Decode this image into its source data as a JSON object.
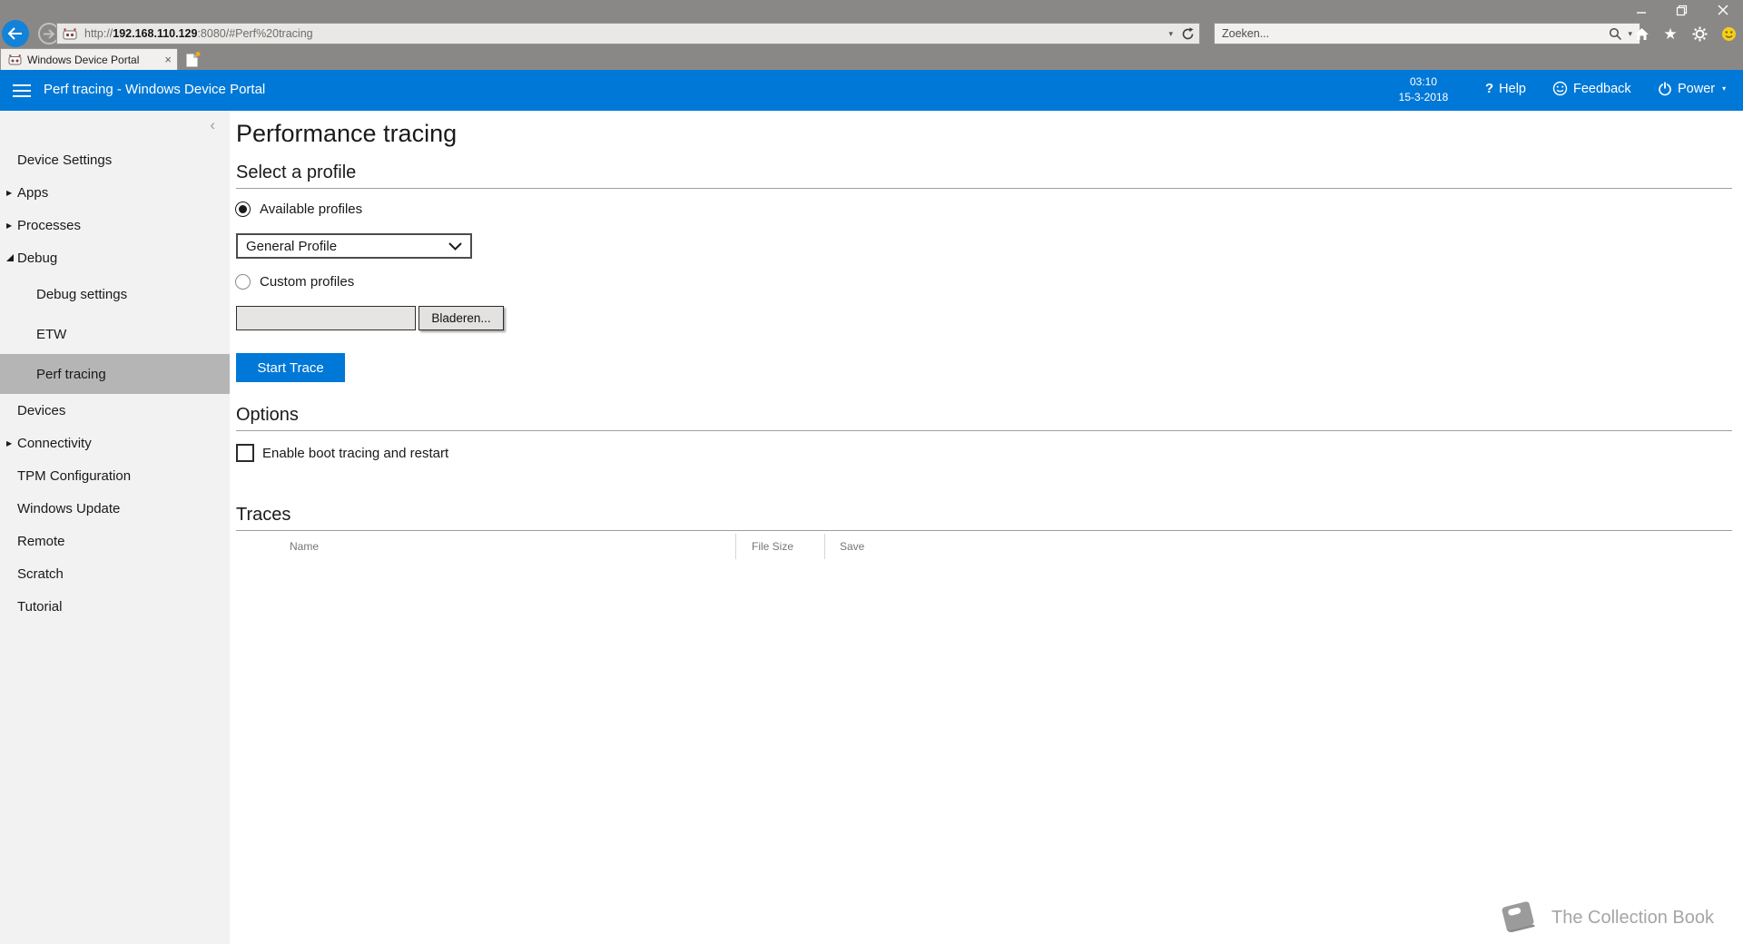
{
  "browser": {
    "icons": {
      "back": "arrow-left",
      "forward": "arrow-right",
      "refresh": "refresh-arrow",
      "address_dropdown": "▾",
      "search_magnifier": "magnifier",
      "search_dropdown": "▾",
      "home": "home",
      "favorites": "★",
      "settings": "gear",
      "smiley": "feedback-smiley",
      "minimize": "minimize",
      "restore": "restore",
      "close": "close"
    },
    "address": {
      "protocol": "http://",
      "host": "192.168.110.129",
      "path": ":8080/#Perf%20tracing"
    },
    "search": {
      "placeholder": "Zoeken..."
    },
    "tab": {
      "title": "Windows Device Portal",
      "close_icon": "×"
    },
    "chrome_color": "#8a8886"
  },
  "app_header": {
    "accent_color": "#0078d7",
    "title": "Perf tracing - Windows Device Portal",
    "time": "03:10",
    "date": "15-3-2018",
    "help": {
      "icon": "?",
      "label": "Help"
    },
    "feedback": {
      "label": "Feedback"
    },
    "power": {
      "label": "Power",
      "caret": "▾"
    }
  },
  "sidebar": {
    "collapse_icon": "‹",
    "selected_bg": "#b5b5b5",
    "items": [
      {
        "label": "Device Settings",
        "state": "plain",
        "selected": false
      },
      {
        "label": "Apps",
        "state": "collapsed",
        "selected": false
      },
      {
        "label": "Processes",
        "state": "collapsed",
        "selected": false
      },
      {
        "label": "Debug",
        "state": "expanded",
        "selected": false
      },
      {
        "label": "Debug settings",
        "state": "sub",
        "selected": false
      },
      {
        "label": "ETW",
        "state": "sub",
        "selected": false
      },
      {
        "label": "Perf tracing",
        "state": "sub",
        "selected": true
      },
      {
        "label": "Devices",
        "state": "plain",
        "selected": false
      },
      {
        "label": "Connectivity",
        "state": "collapsed",
        "selected": false
      },
      {
        "label": "TPM Configuration",
        "state": "plain",
        "selected": false
      },
      {
        "label": "Windows Update",
        "state": "plain",
        "selected": false
      },
      {
        "label": "Remote",
        "state": "plain",
        "selected": false
      },
      {
        "label": "Scratch",
        "state": "plain",
        "selected": false
      },
      {
        "label": "Tutorial",
        "state": "plain",
        "selected": false
      }
    ]
  },
  "main": {
    "page_title": "Performance tracing",
    "profile": {
      "heading": "Select a profile",
      "available_radio": {
        "label": "Available profiles",
        "selected": true
      },
      "profile_select": {
        "value": "General Profile"
      },
      "custom_radio": {
        "label": "Custom profiles",
        "selected": false
      },
      "file_input": {
        "value": "",
        "browse_label": "Bladeren..."
      },
      "start_button": "Start Trace"
    },
    "options": {
      "heading": "Options",
      "boot_checkbox": {
        "label": "Enable boot tracing and restart",
        "checked": false
      }
    },
    "traces": {
      "heading": "Traces",
      "columns": [
        "Name",
        "File Size",
        "Save"
      ],
      "rows": []
    }
  },
  "footer": {
    "brand": "The Collection Book",
    "book_icon": "book"
  }
}
